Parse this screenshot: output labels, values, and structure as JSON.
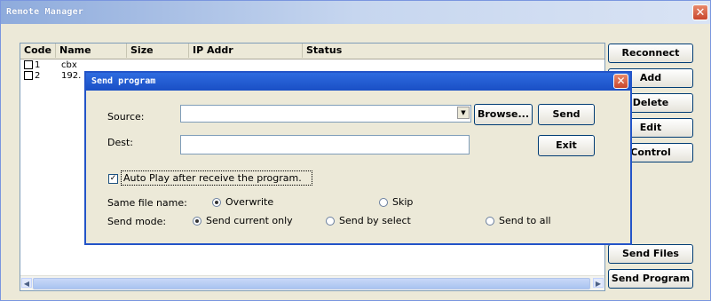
{
  "window": {
    "title": "Remote Manager"
  },
  "list": {
    "columns": [
      "Code",
      "Name",
      "Size",
      "IP Addr",
      "Status"
    ],
    "rows": [
      {
        "code": "1",
        "name": "cbx"
      },
      {
        "code": "2",
        "name": "192."
      }
    ]
  },
  "buttons": {
    "reconnect": "Reconnect",
    "add": "Add",
    "delete": "Delete",
    "edit": "Edit",
    "control": "Control",
    "send_files": "Send Files",
    "send_program": "Send Program"
  },
  "dialog": {
    "title": "Send program",
    "source_label": "Source:",
    "source_value": "",
    "browse": "Browse...",
    "send": "Send",
    "dest_label": "Dest:",
    "dest_value": "",
    "exit": "Exit",
    "autoplay_label": "Auto Play after receive the program.",
    "autoplay_checked": true,
    "same_file_label": "Same file name:",
    "overwrite": "Overwrite",
    "skip": "Skip",
    "send_mode_label": "Send mode:",
    "send_current": "Send current only",
    "send_select": "Send by select",
    "send_all": "Send to all"
  },
  "colors": {
    "title_active": "#1a4fc5",
    "title_inactive": "#c6d6ef",
    "close": "#c8462c"
  }
}
